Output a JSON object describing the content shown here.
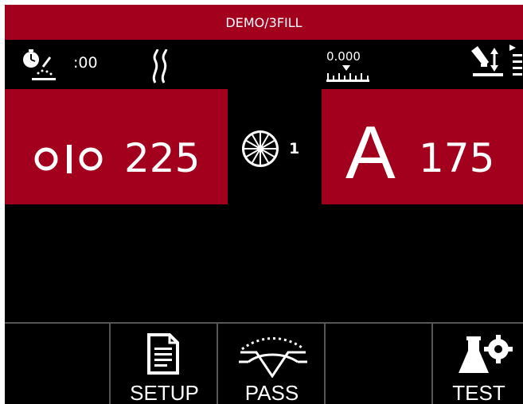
{
  "title": "DEMO/3FILL",
  "status_bar": {
    "timer": ":00",
    "offset_value": "0.000",
    "icons": [
      "arc-timer-icon",
      "preflow-gas-icon",
      "offset-scale-icon",
      "wire-feed-settings-icon"
    ]
  },
  "wire_feed": {
    "icon": "wire-feed-speed-icon",
    "value": "225"
  },
  "arc_control": {
    "icon": "arc-control-wheel-icon",
    "value": "1"
  },
  "amperage": {
    "symbol": "A",
    "value": "175"
  },
  "soft_buttons": [
    {
      "label": "",
      "icon": ""
    },
    {
      "label": "SETUP",
      "icon": "document-icon"
    },
    {
      "label": "PASS",
      "icon": "weld-pass-icon"
    },
    {
      "label": "",
      "icon": ""
    },
    {
      "label": "TEST",
      "icon": "flask-gear-icon"
    }
  ],
  "colors": {
    "accent": "#a3001e",
    "background": "#000000",
    "text": "#ffffff"
  }
}
